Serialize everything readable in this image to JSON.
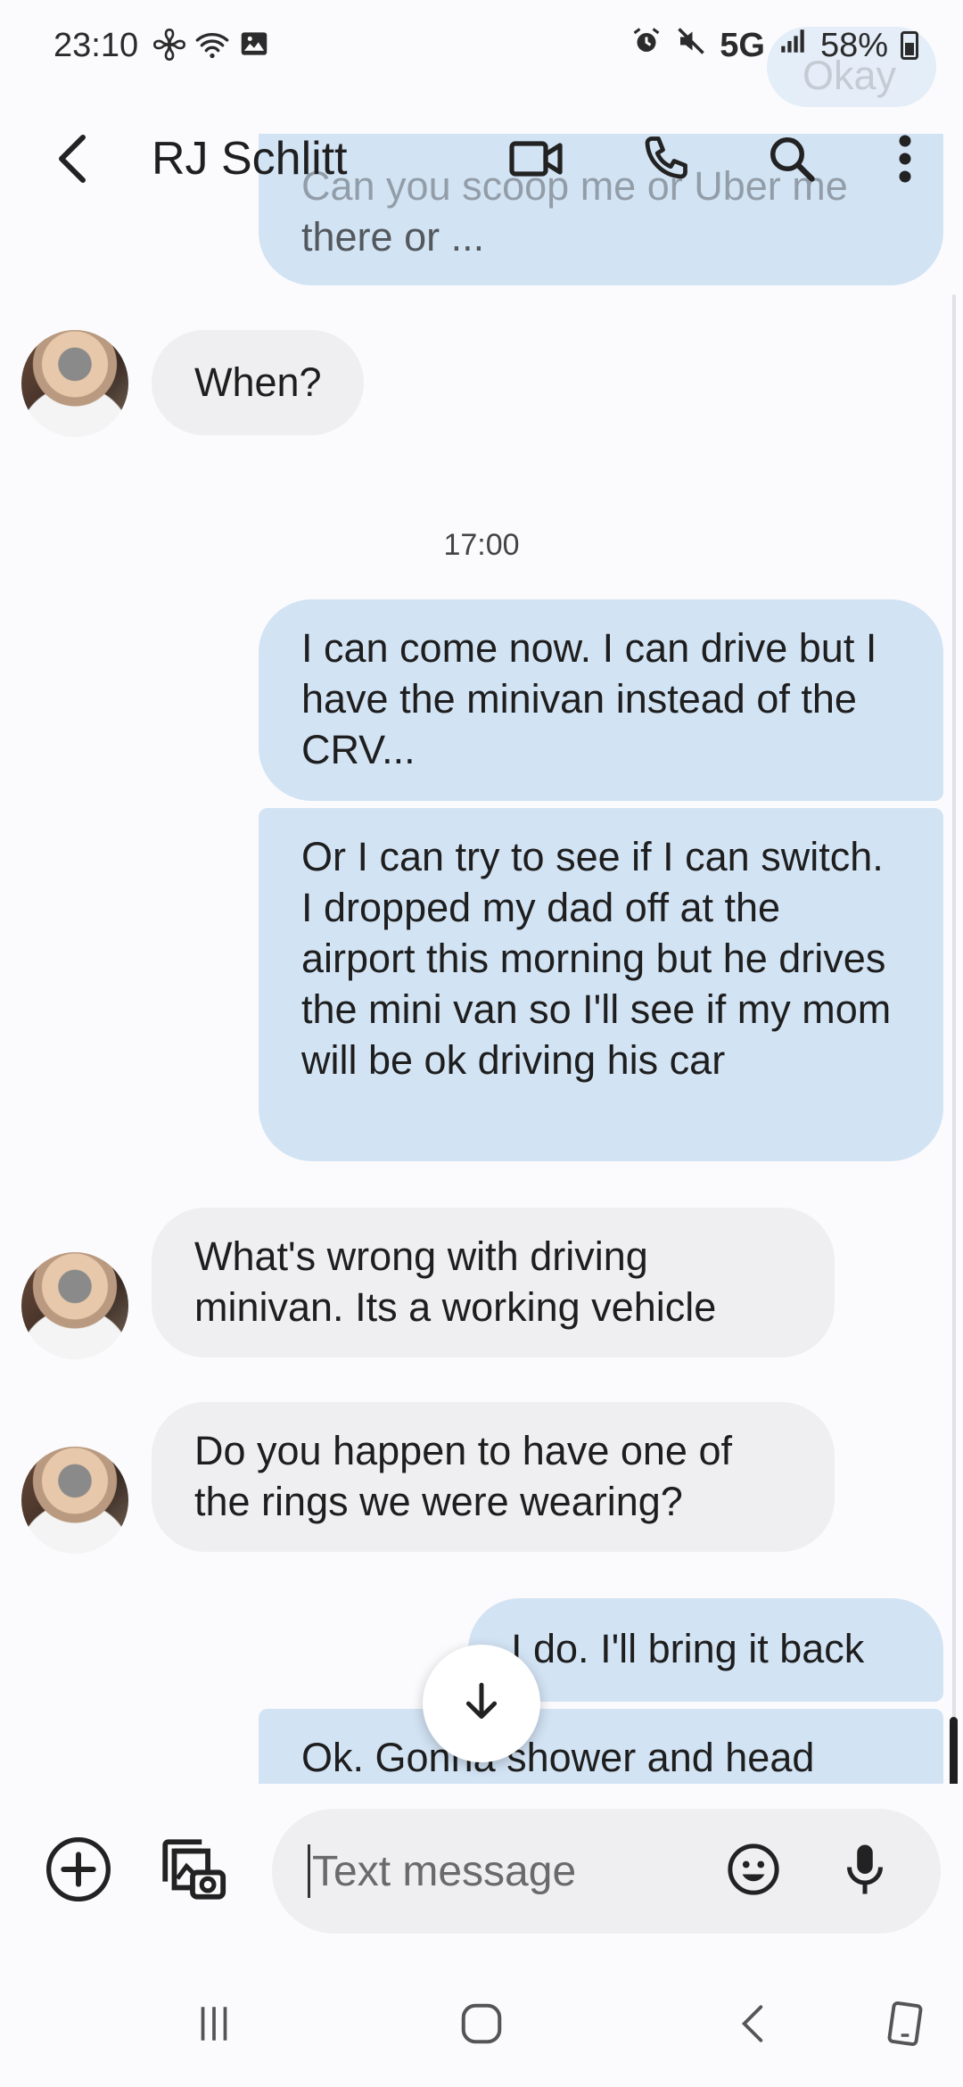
{
  "status_bar": {
    "time": "23:10",
    "network": "5G",
    "battery": "58%"
  },
  "header": {
    "contact_name": "RJ Schlitt"
  },
  "messages": {
    "ghost_top": "Okay",
    "partial_top_line1": "Can you scoop me or Uber me",
    "partial_top_line2": "there or ...",
    "timestamp": "17:00",
    "in_1": "When?",
    "out_1": "I can come now. I can drive but I have the minivan instead of the CRV...",
    "out_2": "Or I can try to see if I can switch. I dropped my dad off at the airport this morning but he drives the mini van so I'll see if my mom will be ok driving his car",
    "in_2": "What's wrong with driving minivan. Its a working vehicle",
    "in_3": "Do you happen to have one of the rings we were wearing?",
    "out_3": "I do. I'll bring it back",
    "out_4": "Ok. Gonna shower and head over."
  },
  "composer": {
    "placeholder": "Text message"
  },
  "colors": {
    "outgoing_bubble": "#d2e3f4",
    "incoming_bubble": "#efeff1",
    "background": "#fbfbfd"
  },
  "icons": {
    "back": "back-arrow-icon",
    "video": "video-call-icon",
    "phone": "phone-icon",
    "search": "search-icon",
    "more": "more-vert-icon",
    "add": "plus-circle-icon",
    "gallery": "gallery-camera-icon",
    "emoji": "emoji-icon",
    "mic": "mic-icon",
    "jump": "arrow-down-icon"
  }
}
